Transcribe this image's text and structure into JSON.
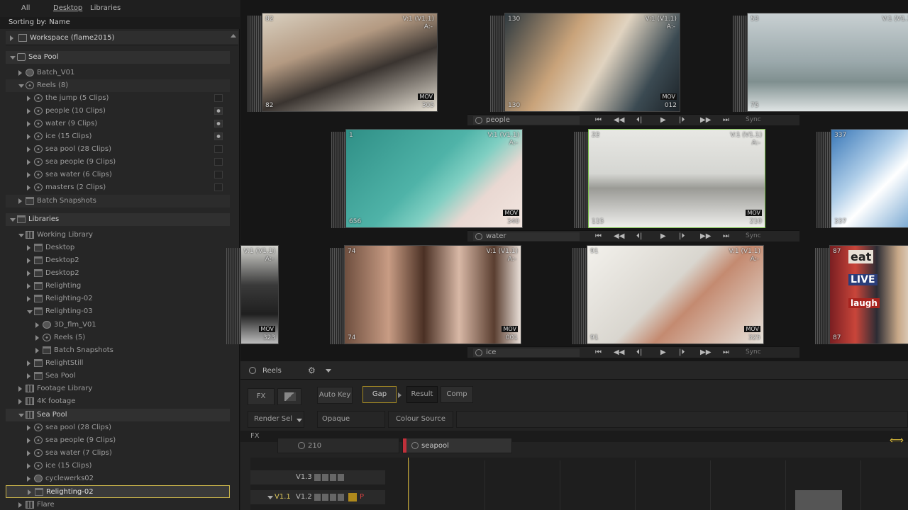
{
  "browser": {
    "tabs": [
      {
        "label": "All"
      },
      {
        "label": "Desktop"
      },
      {
        "label": "Libraries"
      }
    ],
    "sorting_label": "Sorting by: Name",
    "workspace_label": "Workspace (flame2015)",
    "tree": [
      {
        "label": "Sea Pool",
        "icon": "pool-icon",
        "level": 1,
        "twist": "down",
        "header": true
      },
      {
        "label": "Batch_V01",
        "icon": "batch-icon",
        "level": 2,
        "twist": "right"
      },
      {
        "label": "Reels (8)",
        "icon": "reel-icon",
        "level": 2,
        "twist": "down",
        "dim": true
      },
      {
        "label": "the jump (5 Clips)",
        "icon": "reel-icon",
        "level": 3,
        "twist": "right",
        "eye": false
      },
      {
        "label": "people (10 Clips)",
        "icon": "reel-icon",
        "level": 3,
        "twist": "right",
        "eye": true
      },
      {
        "label": "water (9 Clips)",
        "icon": "reel-icon",
        "level": 3,
        "twist": "right",
        "eye": true
      },
      {
        "label": "ice (15 Clips)",
        "icon": "reel-icon",
        "level": 3,
        "twist": "right",
        "eye": true
      },
      {
        "label": "sea pool (28 Clips)",
        "icon": "reel-icon",
        "level": 3,
        "twist": "right",
        "eye": false
      },
      {
        "label": "sea people (9 Clips)",
        "icon": "reel-icon",
        "level": 3,
        "twist": "right",
        "eye": false
      },
      {
        "label": "sea water (6 Clips)",
        "icon": "reel-icon",
        "level": 3,
        "twist": "right",
        "eye": false
      },
      {
        "label": "masters (2 Clips)",
        "icon": "reel-icon",
        "level": 3,
        "twist": "right",
        "eye": false
      },
      {
        "label": "Batch Snapshots",
        "icon": "folder-icon",
        "level": 2,
        "twist": "right",
        "dim": true
      },
      {
        "label": "Libraries",
        "icon": "folder-icon",
        "level": 1,
        "twist": "down",
        "header": true
      },
      {
        "label": "Working Library",
        "icon": "library-icon",
        "level": 2,
        "twist": "down"
      },
      {
        "label": "Desktop",
        "icon": "folder-icon",
        "level": 3,
        "twist": "right"
      },
      {
        "label": "Desktop2",
        "icon": "folder-icon",
        "level": 3,
        "twist": "right"
      },
      {
        "label": "Desktop2",
        "icon": "folder-icon",
        "level": 3,
        "twist": "right"
      },
      {
        "label": "Relighting",
        "icon": "folder-icon",
        "level": 3,
        "twist": "right"
      },
      {
        "label": "Relighting-02",
        "icon": "folder-icon",
        "level": 3,
        "twist": "right"
      },
      {
        "label": "Relighting-03",
        "icon": "folder-icon",
        "level": 3,
        "twist": "down"
      },
      {
        "label": "3D_flm_V01",
        "icon": "batch-icon",
        "level": 4,
        "twist": "right"
      },
      {
        "label": "Reels (5)",
        "icon": "reel-icon",
        "level": 4,
        "twist": "right"
      },
      {
        "label": "Batch Snapshots",
        "icon": "folder-icon",
        "level": 4,
        "twist": "right"
      },
      {
        "label": "RelightStill",
        "icon": "folder-icon",
        "level": 3,
        "twist": "right"
      },
      {
        "label": "Sea Pool",
        "icon": "folder-icon",
        "level": 3,
        "twist": "right"
      },
      {
        "label": "Footage Library",
        "icon": "library-icon",
        "level": 2,
        "twist": "right"
      },
      {
        "label": "4K footage",
        "icon": "library-icon",
        "level": 2,
        "twist": "right"
      },
      {
        "label": "Sea Pool",
        "icon": "library-icon",
        "level": 2,
        "twist": "down",
        "header": true
      },
      {
        "label": "sea pool (28 Clips)",
        "icon": "reel-icon",
        "level": 3,
        "twist": "right"
      },
      {
        "label": "sea people (9 Clips)",
        "icon": "reel-icon",
        "level": 3,
        "twist": "right"
      },
      {
        "label": "sea water (7 Clips)",
        "icon": "reel-icon",
        "level": 3,
        "twist": "right"
      },
      {
        "label": "ice (15 Clips)",
        "icon": "reel-icon",
        "level": 3,
        "twist": "right"
      },
      {
        "label": "cyclewerks02",
        "icon": "batch-icon",
        "level": 3,
        "twist": "right"
      },
      {
        "label": "Relighting-02",
        "icon": "folder-icon",
        "level": 3,
        "twist": "right",
        "selected": true
      },
      {
        "label": "Flare",
        "icon": "library-icon",
        "level": 2,
        "twist": "right"
      }
    ]
  },
  "reels": [
    {
      "name": "people",
      "clips": [
        {
          "tl": "82",
          "tr": "V:1 (V1.1)",
          "tr2": "A:-",
          "bl": "82",
          "br": "305",
          "mov": "MOV",
          "palette": "beach"
        },
        {
          "tl": "130",
          "tr": "V:1 (V1.1)",
          "tr2": "A:-",
          "bl": "130",
          "br": "012",
          "mov": "MOV",
          "palette": "warm"
        },
        {
          "tl": "53",
          "tr": "V:1 (V1.1)",
          "tr2": "",
          "bl": "75",
          "br": "",
          "mov": "",
          "palette": "ocean"
        }
      ]
    },
    {
      "name": "water",
      "clips": [
        {
          "tl": "1",
          "tr": "V:1 (V1.1)",
          "tr2": "A:-",
          "bl": "656",
          "br": "340",
          "mov": "MOV",
          "palette": "pool"
        },
        {
          "tl": "22",
          "tr": "V:1 (V1.1)",
          "tr2": "A:-",
          "bl": "115",
          "br": "210",
          "mov": "MOV",
          "palette": "fog"
        },
        {
          "tl": "337",
          "tr": "",
          "tr2": "",
          "bl": "337",
          "br": "",
          "mov": "",
          "palette": "wave"
        }
      ]
    },
    {
      "name": "ice",
      "clips": [
        {
          "tl": "",
          "tr": "V:1 (V1.1)",
          "tr2": "A:-",
          "bl": "",
          "br": "323",
          "mov": "MOV",
          "palette": "dark"
        },
        {
          "tl": "74",
          "tr": "V:1 (V1.1)",
          "tr2": "A:-",
          "bl": "74",
          "br": "001",
          "mov": "MOV",
          "palette": "skin"
        },
        {
          "tl": "91",
          "tr": "V:1 (V1.1)",
          "tr2": "A:-",
          "bl": "91",
          "br": "325",
          "mov": "MOV",
          "palette": "ice"
        },
        {
          "tl": "87",
          "tr": "",
          "tr2": "",
          "bl": "87",
          "br": "",
          "mov": "",
          "palette": "signs",
          "sign_top": "eat",
          "sign_mid": "LIVE",
          "sign_low": "laugh"
        }
      ]
    }
  ],
  "transport": {
    "sync_label": "Sync"
  },
  "controls": {
    "reels_label": "Reels",
    "fx_label": "FX",
    "auto_key_label": "Auto Key",
    "gap_label": "Gap",
    "result_label": "Result",
    "comp_label": "Comp",
    "render_sel_label": "Render Sel",
    "opaque_label": "Opaque",
    "colour_source_label": "Colour Source",
    "fx_row_label": "FX",
    "seq_frame": "210",
    "seq_name": "seapool",
    "track_v13": "V1.3",
    "track_v11": "V1.1",
    "track_v12": "V1.2",
    "track_p": "P"
  },
  "colors": {
    "accent": "#c7b24a",
    "active": "#7bc24a",
    "record": "#c0303a"
  }
}
